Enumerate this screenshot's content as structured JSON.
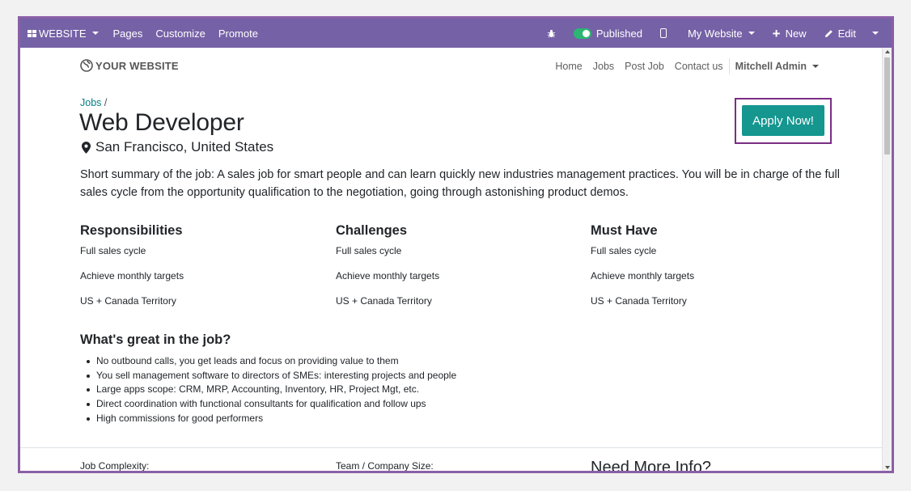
{
  "topbar": {
    "website_label": "WEBSITE",
    "pages": "Pages",
    "customize": "Customize",
    "promote": "Promote",
    "published": "Published",
    "my_website": "My Website",
    "new": "New",
    "edit": "Edit"
  },
  "nav": {
    "logo_text": "YOUR WEBSITE",
    "items": [
      "Home",
      "Jobs",
      "Post Job",
      "Contact us"
    ],
    "user": "Mitchell Admin"
  },
  "job": {
    "breadcrumb_link": "Jobs",
    "breadcrumb_sep": "/",
    "title": "Web Developer",
    "location": "San Francisco, United States",
    "apply_label": "Apply Now!",
    "summary": "Short summary of the job: A sales job for smart people and can learn quickly new industries management practices. You will be in charge of the full sales cycle from the opportunity qualification to the negotiation, going through astonishing product demos.",
    "columns": [
      {
        "heading": "Responsibilities",
        "items": [
          "Full sales cycle",
          "Achieve monthly targets",
          "US + Canada Territory"
        ]
      },
      {
        "heading": "Challenges",
        "items": [
          "Full sales cycle",
          "Achieve monthly targets",
          "US + Canada Territory"
        ]
      },
      {
        "heading": "Must Have",
        "items": [
          "Full sales cycle",
          "Achieve monthly targets",
          "US + Canada Territory"
        ]
      }
    ],
    "great_heading": "What's great in the job?",
    "great_items": [
      "No outbound calls, you get leads and focus on providing value to them",
      "You sell management software to directors of SMEs: interesting projects and people",
      "Large apps scope: CRM, MRP, Accounting, Inventory, HR, Project Mgt, etc.",
      "Direct coordination with functional consultants for qualification and follow ups",
      "High commissions for good performers"
    ],
    "footer": {
      "complexity": "Job Complexity:",
      "team_size": "Team / Company Size:",
      "need_info": "Need More Info?"
    }
  },
  "colors": {
    "topbar": "#7561a6",
    "apply_button": "#15968f",
    "link": "#017e84",
    "toggle_on": "#2bb673"
  }
}
